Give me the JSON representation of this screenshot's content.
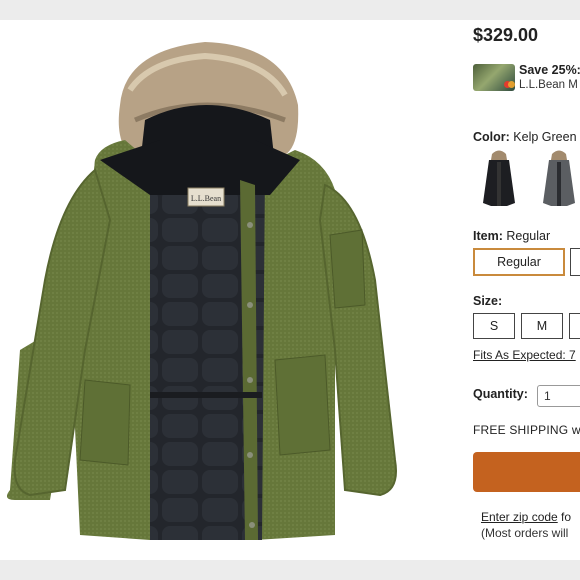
{
  "price": "$329.00",
  "card_offer": {
    "save_text": "Save 25%:",
    "sub_text": "L.L.Bean M"
  },
  "color": {
    "label": "Color:",
    "value": "Kelp Green",
    "swatches": [
      "black-parka",
      "gray-parka"
    ]
  },
  "item": {
    "label": "Item:",
    "value": "Regular",
    "options": [
      "Regular",
      ""
    ]
  },
  "size": {
    "label": "Size:",
    "options": [
      "S",
      "M",
      ""
    ]
  },
  "fit_link": "Fits As Expected: 7",
  "quantity": {
    "label": "Quantity:",
    "value": "1"
  },
  "shipping_text": "FREE SHIPPING w",
  "zip": {
    "link": "Enter zip code",
    "rest": " fo"
  },
  "orders_text": "(Most orders will",
  "image_label": "L.L.Bean",
  "colors": {
    "jacket": "#66773a",
    "lining": "#1d1f24",
    "fur": "#b9a78c",
    "cta": "#c4621f",
    "selected_border": "#c98a3c"
  }
}
